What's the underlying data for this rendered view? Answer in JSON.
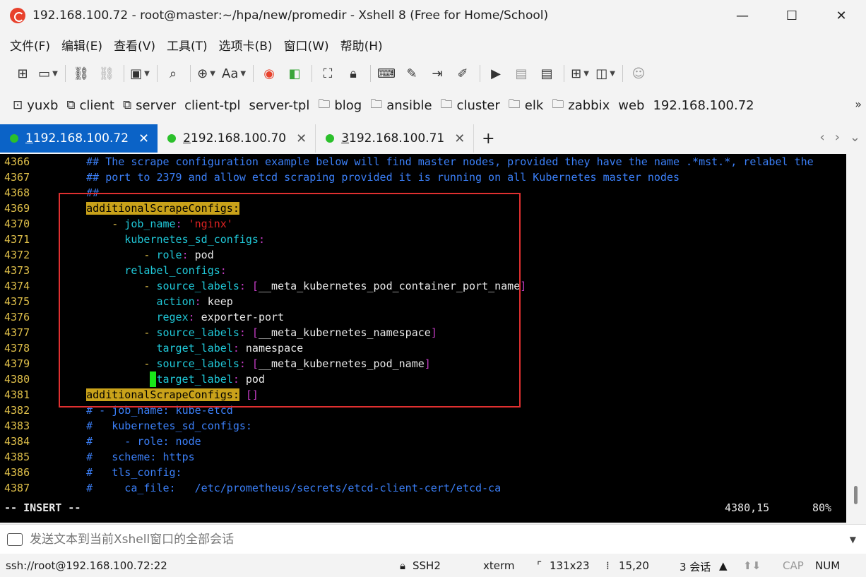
{
  "window": {
    "title": "192.168.100.72 - root@master:~/hpa/new/promedir - Xshell 8 (Free for Home/School)",
    "minimize_icon": "minimize-icon",
    "maximize_icon": "maximize-icon",
    "close_icon": "close-icon"
  },
  "menu": [
    "文件(F)",
    "编辑(E)",
    "查看(V)",
    "工具(T)",
    "选项卡(B)",
    "窗口(W)",
    "帮助(H)"
  ],
  "toolbar_icons": [
    "new-session-icon",
    "open-folder-icon",
    "disconnect-icon",
    "reconnect-icon",
    "properties-icon",
    "find-icon",
    "globe-icon",
    "font-icon",
    "xshell-icon",
    "xftp-icon",
    "fullscreen-icon",
    "lock-icon",
    "keyboard-icon",
    "compose-icon",
    "transfer-icon",
    "script-icon",
    "run-icon",
    "log-icon",
    "notes-icon",
    "add-tab-icon",
    "layout-icon",
    "chat-icon"
  ],
  "toolbar": {
    "font_label": "Aa"
  },
  "links": [
    {
      "label": "yuxb",
      "icon": "session-group-icon"
    },
    {
      "label": "client",
      "icon": "external-link-icon"
    },
    {
      "label": "server",
      "icon": "external-link-icon"
    },
    {
      "label": "client-tpl",
      "icon": ""
    },
    {
      "label": "server-tpl",
      "icon": ""
    },
    {
      "label": "blog",
      "icon": "folder-icon"
    },
    {
      "label": "ansible",
      "icon": "folder-icon"
    },
    {
      "label": "cluster",
      "icon": "folder-icon"
    },
    {
      "label": "elk",
      "icon": "folder-icon"
    },
    {
      "label": "zabbix",
      "icon": "folder-icon"
    },
    {
      "label": "web",
      "icon": ""
    },
    {
      "label": "192.168.100.72",
      "icon": ""
    }
  ],
  "tabs": [
    {
      "num": "1",
      "label": " 192.168.100.72",
      "active": true
    },
    {
      "num": "2",
      "label": " 192.168.100.70",
      "active": false
    },
    {
      "num": "3",
      "label": " 192.168.100.71",
      "active": false
    }
  ],
  "tab_add": "+",
  "terminal": {
    "lines": [
      {
        "n": "4366",
        "parts": [
          {
            "t": "    ## The scrape configuration example below will find master nodes, provided they have the name .*mst.*, relabel the",
            "c": "c-comment"
          }
        ]
      },
      {
        "n": "4367",
        "parts": [
          {
            "t": "    ## port to 2379 and allow etcd scraping provided it is running on all Kubernetes master nodes",
            "c": "c-comment"
          }
        ]
      },
      {
        "n": "4368",
        "parts": [
          {
            "t": "    ##",
            "c": "c-comment"
          }
        ]
      },
      {
        "n": "4369",
        "parts": [
          {
            "t": "    ",
            "c": "c-val"
          },
          {
            "t": "additionalScrapeConfigs:",
            "c": "c-hl"
          }
        ]
      },
      {
        "n": "4370",
        "parts": [
          {
            "t": "        ",
            "c": "c-val"
          },
          {
            "t": "-",
            "c": "c-dash"
          },
          {
            "t": " job_name",
            "c": "c-key"
          },
          {
            "t": ":",
            "c": "c-colon"
          },
          {
            "t": " 'nginx'",
            "c": "c-str"
          }
        ]
      },
      {
        "n": "4371",
        "parts": [
          {
            "t": "          kubernetes_sd_configs",
            "c": "c-key"
          },
          {
            "t": ":",
            "c": "c-colon"
          }
        ]
      },
      {
        "n": "4372",
        "parts": [
          {
            "t": "             ",
            "c": "c-val"
          },
          {
            "t": "-",
            "c": "c-dash"
          },
          {
            "t": " role",
            "c": "c-key"
          },
          {
            "t": ":",
            "c": "c-colon"
          },
          {
            "t": " pod",
            "c": "c-val"
          }
        ]
      },
      {
        "n": "4373",
        "parts": [
          {
            "t": "          relabel_configs",
            "c": "c-key"
          },
          {
            "t": ":",
            "c": "c-colon"
          }
        ]
      },
      {
        "n": "4374",
        "parts": [
          {
            "t": "             ",
            "c": "c-val"
          },
          {
            "t": "-",
            "c": "c-dash"
          },
          {
            "t": " source_labels",
            "c": "c-key"
          },
          {
            "t": ":",
            "c": "c-colon"
          },
          {
            "t": " [",
            "c": "c-br"
          },
          {
            "t": "__meta_kubernetes_pod_container_port_name",
            "c": "c-val"
          },
          {
            "t": "]",
            "c": "c-br"
          }
        ]
      },
      {
        "n": "4375",
        "parts": [
          {
            "t": "               action",
            "c": "c-key"
          },
          {
            "t": ":",
            "c": "c-colon"
          },
          {
            "t": " keep",
            "c": "c-val"
          }
        ]
      },
      {
        "n": "4376",
        "parts": [
          {
            "t": "               regex",
            "c": "c-key"
          },
          {
            "t": ":",
            "c": "c-colon"
          },
          {
            "t": " exporter-port",
            "c": "c-val"
          }
        ]
      },
      {
        "n": "4377",
        "parts": [
          {
            "t": "             ",
            "c": "c-val"
          },
          {
            "t": "-",
            "c": "c-dash"
          },
          {
            "t": " source_labels",
            "c": "c-key"
          },
          {
            "t": ":",
            "c": "c-colon"
          },
          {
            "t": " [",
            "c": "c-br"
          },
          {
            "t": "__meta_kubernetes_namespace",
            "c": "c-val"
          },
          {
            "t": "]",
            "c": "c-br"
          }
        ]
      },
      {
        "n": "4378",
        "parts": [
          {
            "t": "               target_label",
            "c": "c-key"
          },
          {
            "t": ":",
            "c": "c-colon"
          },
          {
            "t": " namespace",
            "c": "c-val"
          }
        ]
      },
      {
        "n": "4379",
        "parts": [
          {
            "t": "             ",
            "c": "c-val"
          },
          {
            "t": "-",
            "c": "c-dash"
          },
          {
            "t": " source_labels",
            "c": "c-key"
          },
          {
            "t": ":",
            "c": "c-colon"
          },
          {
            "t": " [",
            "c": "c-br"
          },
          {
            "t": "__meta_kubernetes_pod_name",
            "c": "c-val"
          },
          {
            "t": "]",
            "c": "c-br"
          }
        ]
      },
      {
        "n": "4380",
        "parts": [
          {
            "t": "              ",
            "c": "c-val"
          },
          {
            "t": "",
            "c": "cursor"
          },
          {
            "t": "target_label",
            "c": "c-key"
          },
          {
            "t": ":",
            "c": "c-colon"
          },
          {
            "t": " pod",
            "c": "c-val"
          }
        ]
      },
      {
        "n": "4381",
        "parts": [
          {
            "t": "    ",
            "c": "c-val"
          },
          {
            "t": "additionalScrapeConfigs:",
            "c": "c-hl"
          },
          {
            "t": " []",
            "c": "c-br"
          }
        ]
      },
      {
        "n": "4382",
        "parts": [
          {
            "t": "    # - job_name: kube-etcd",
            "c": "c-comment"
          }
        ]
      },
      {
        "n": "4383",
        "parts": [
          {
            "t": "    #   kubernetes_sd_configs:",
            "c": "c-comment"
          }
        ]
      },
      {
        "n": "4384",
        "parts": [
          {
            "t": "    #     - role: node",
            "c": "c-comment"
          }
        ]
      },
      {
        "n": "4385",
        "parts": [
          {
            "t": "    #   scheme: https",
            "c": "c-comment"
          }
        ]
      },
      {
        "n": "4386",
        "parts": [
          {
            "t": "    #   tls_config:",
            "c": "c-comment"
          }
        ]
      },
      {
        "n": "4387",
        "parts": [
          {
            "t": "    #     ca_file:   /etc/prometheus/secrets/etcd-client-cert/etcd-ca",
            "c": "c-comment"
          }
        ]
      }
    ],
    "mode": "-- INSERT --",
    "position": "4380,15",
    "percent": "80%"
  },
  "sendbar": {
    "placeholder": "发送文本到当前Xshell窗口的全部会话"
  },
  "status": {
    "connection": "ssh://root@192.168.100.72:22",
    "protocol": "SSH2",
    "term": "xterm",
    "size": "131x23",
    "cursor": "15,20",
    "sessions": "3 会话",
    "cap": "CAP",
    "num": "NUM"
  },
  "colors": {
    "active_tab": "#0b63c7",
    "highlight": "#c9a21a",
    "comment": "#3b7ff7",
    "key": "#20c9d9",
    "box": "#e03030"
  }
}
